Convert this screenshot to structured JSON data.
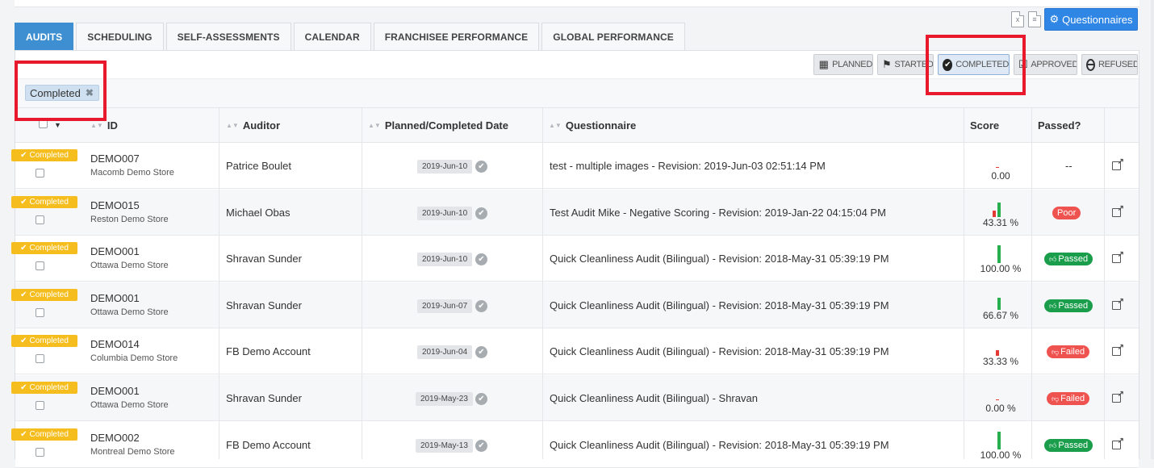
{
  "tabs": [
    "AUDITS",
    "SCHEDULING",
    "SELF-ASSESSMENTS",
    "CALENDAR",
    "FRANCHISEE PERFORMANCE",
    "GLOBAL PERFORMANCE"
  ],
  "active_tab": "AUDITS",
  "toolbar": {
    "excel_icon": "excel-file-icon",
    "doc_icon": "document-file-icon",
    "questionnaires_label": "Questionnaires"
  },
  "status_filters": {
    "planned": "PLANNED",
    "started": "STARTED",
    "completed": "COMPLETED",
    "approved": "APPROVED",
    "refused": "REFUSED",
    "active": "COMPLETED"
  },
  "active_filter_chip": "Completed",
  "columns": {
    "id": "ID",
    "auditor": "Auditor",
    "date": "Planned/Completed Date",
    "questionnaire": "Questionnaire",
    "score": "Score",
    "passed": "Passed?"
  },
  "colors": {
    "tab_active": "#3d8fd1",
    "button_primary": "#2f86e5",
    "badge_completed": "#f5bd1e",
    "passed": "#1a9e4b",
    "failed": "#ef5350",
    "bar_green": "#27ae4f",
    "bar_red": "#e53935",
    "highlight": "#e8192c"
  },
  "rows": [
    {
      "status": "Completed",
      "id": "DEMO007",
      "store": "Macomb Demo Store",
      "auditor": "Patrice Boulet",
      "date": "2019-Jun-10",
      "questionnaire": "test - multiple images - Revision: 2019-Jun-03 02:51:14 PM",
      "score": "0.00",
      "score_green": 0,
      "score_red": 0,
      "passed": "--",
      "passed_type": "none"
    },
    {
      "status": "Completed",
      "id": "DEMO015",
      "store": "Reston Demo Store",
      "auditor": "Michael Obas",
      "date": "2019-Jun-10",
      "questionnaire": "Test Audit Mike - Negative Scoring - Revision: 2019-Jan-22 04:15:04 PM",
      "score": "43.31 %",
      "score_green": 0.8,
      "score_red": 0.35,
      "passed": "Poor",
      "passed_type": "poor"
    },
    {
      "status": "Completed",
      "id": "DEMO001",
      "store": "Ottawa Demo Store",
      "auditor": "Shravan Sunder",
      "date": "2019-Jun-10",
      "questionnaire": "Quick Cleanliness Audit (Bilingual) - Revision: 2018-May-31 05:39:19 PM",
      "score": "100.00 %",
      "score_green": 1.0,
      "score_red": 0,
      "passed": "Passed",
      "passed_type": "pass"
    },
    {
      "status": "Completed",
      "id": "DEMO001",
      "store": "Ottawa Demo Store",
      "auditor": "Shravan Sunder",
      "date": "2019-Jun-07",
      "questionnaire": "Quick Cleanliness Audit (Bilingual) - Revision: 2018-May-31 05:39:19 PM",
      "score": "66.67 %",
      "score_green": 0.67,
      "score_red": 0,
      "passed": "Passed",
      "passed_type": "pass"
    },
    {
      "status": "Completed",
      "id": "DEMO014",
      "store": "Columbia Demo Store",
      "auditor": "FB Demo Account",
      "date": "2019-Jun-04",
      "questionnaire": "Quick Cleanliness Audit (Bilingual) - Revision: 2018-May-31 05:39:19 PM",
      "score": "33.33 %",
      "score_green": 0,
      "score_red": 0.33,
      "passed": "Failed",
      "passed_type": "fail"
    },
    {
      "status": "Completed",
      "id": "DEMO001",
      "store": "Ottawa Demo Store",
      "auditor": "Shravan Sunder",
      "date": "2019-May-23",
      "questionnaire": "Quick Cleanliness Audit (Bilingual) - Shravan",
      "score": "0.00 %",
      "score_green": 0,
      "score_red": 0,
      "passed": "Failed",
      "passed_type": "fail"
    },
    {
      "status": "Completed",
      "id": "DEMO002",
      "store": "Montreal Demo Store",
      "auditor": "FB Demo Account",
      "date": "2019-May-13",
      "questionnaire": "Quick Cleanliness Audit (Bilingual) - Revision: 2018-May-31 05:39:19 PM",
      "score": "100.00 %",
      "score_green": 1.0,
      "score_red": 0,
      "passed": "Passed",
      "passed_type": "pass"
    }
  ]
}
